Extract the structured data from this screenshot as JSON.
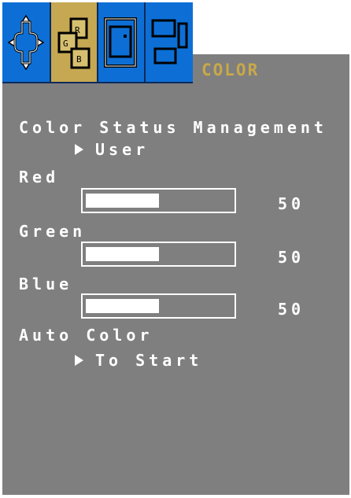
{
  "colors": {
    "tab_blue": "#0d6fd6",
    "tab_active": "#c6a852",
    "title_gold": "#c8a84a",
    "panel_gray": "#7f7f7f",
    "text_white": "#ffffff"
  },
  "tabs": [
    {
      "icon": "position-icon",
      "active": false
    },
    {
      "icon": "color-icon",
      "active": true
    },
    {
      "icon": "size-icon",
      "active": false
    },
    {
      "icon": "pip-icon",
      "active": false
    }
  ],
  "menu": {
    "title": "COLOR"
  },
  "color_status": {
    "label": "Color Status Management",
    "value": "User"
  },
  "sliders": [
    {
      "label": "Red",
      "value": "50",
      "level": 0.5
    },
    {
      "label": "Green",
      "value": "50",
      "level": 0.5
    },
    {
      "label": "Blue",
      "value": "50",
      "level": 0.5
    }
  ],
  "auto_color": {
    "label": "Auto Color",
    "action": "To Start"
  }
}
